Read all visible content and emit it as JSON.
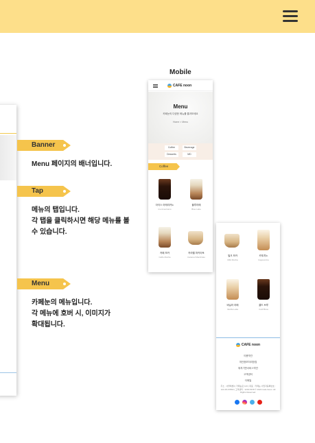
{
  "header": {
    "menu_icon": "hamburger-icon",
    "background": "#fddf8a"
  },
  "mobile_label": "Mobile",
  "annotations": [
    {
      "tag": "Banner",
      "lines": [
        "Menu 페이지의 배너입니다."
      ]
    },
    {
      "tag": "Tap",
      "lines": [
        "메뉴의 탭입니다.",
        "각 탭을 클릭하시면 해당 메뉴를 볼",
        "수 있습니다."
      ]
    },
    {
      "tag": "Menu",
      "lines": [
        "카페눈의 메뉴입니다.",
        "각 메뉴에 호버 시, 이미지가",
        "확대됩니다."
      ]
    }
  ],
  "accent": "#f5c44c",
  "mobile_preview": {
    "logo": "CAFE noon",
    "banner_title": "Menu",
    "banner_sub": "카페눈의 다양한 메뉴를 즐겨보세요",
    "breadcrumb": "Home > Menu",
    "tabs": [
      "Coffee",
      "Beverage",
      "Desserts",
      "MD"
    ],
    "category": "Coffee",
    "items": [
      {
        "name": "아이스 아메리카노",
        "eng": "Ice Americano"
      },
      {
        "name": "블루라떼",
        "eng": "Blue Latte"
      },
      {
        "name": "카페 모카",
        "eng": "Caffe Mocha"
      },
      {
        "name": "카라멜 마키아토",
        "eng": "Caramel Macchiato"
      }
    ],
    "items2": [
      {
        "name": "밀크 모카",
        "eng": "Milk Mocha"
      },
      {
        "name": "카푸치노",
        "eng": "Cappuccino"
      },
      {
        "name": "바닐라 라떼",
        "eng": "Vanilla Latte"
      },
      {
        "name": "콜드 브루",
        "eng": "Cold Brew"
      }
    ],
    "footer_logo": "CAFE noon",
    "footer_links": [
      "이용약관",
      "개인정보처리방침",
      "위치기반서비스약관",
      "고객센터",
      "이메일"
    ],
    "footer_info": "주소 : 서울특별시 카페눈로 123 | 대표 : 카페눈 사업자등록번호 : 123-45-67890 | 고객센터 : 1234-5678 © 2023 Cafe Noon. All Rights Reserved."
  }
}
